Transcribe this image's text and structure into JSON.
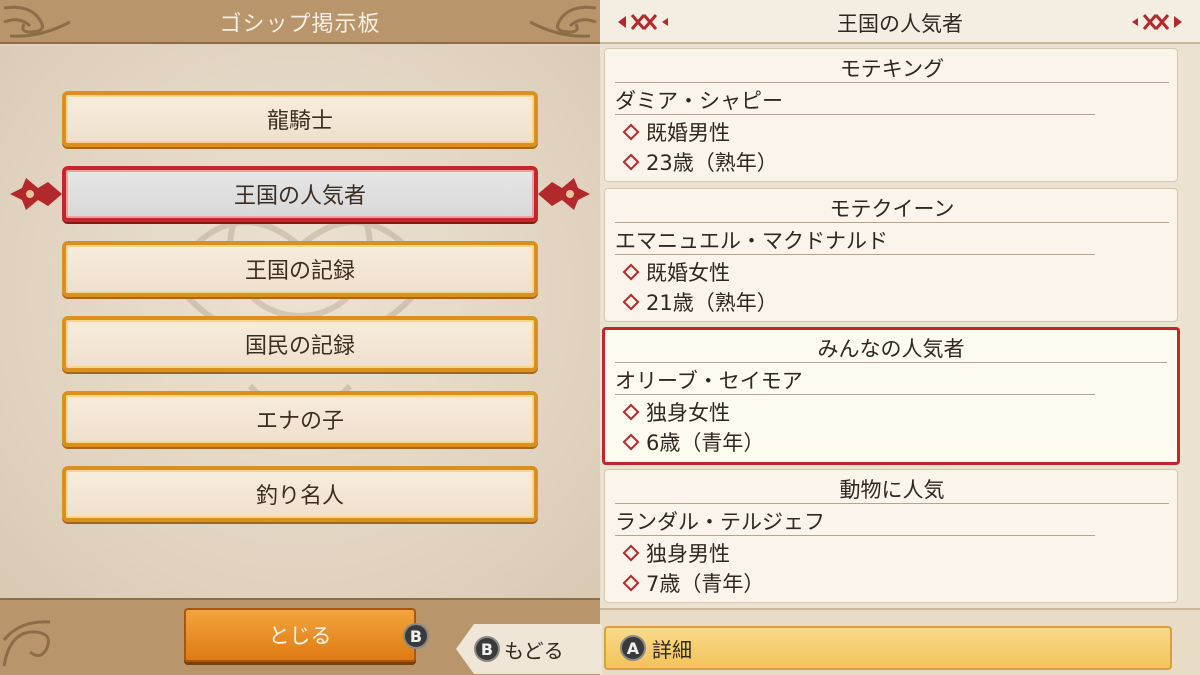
{
  "left": {
    "title": "ゴシップ掲示板",
    "menu": [
      {
        "label": "龍騎士"
      },
      {
        "label": "王国の人気者"
      },
      {
        "label": "王国の記録"
      },
      {
        "label": "国民の記録"
      },
      {
        "label": "エナの子"
      },
      {
        "label": "釣り名人"
      }
    ],
    "selected_index": 1,
    "close_label": "とじる",
    "close_button_glyph": "B"
  },
  "right": {
    "title": "王国の人気者",
    "cards": [
      {
        "category": "モテキング",
        "name": "ダミア・シャピー",
        "status": "既婚男性",
        "age": "23歳（熟年）"
      },
      {
        "category": "モテクイーン",
        "name": "エマニュエル・マクドナルド",
        "status": "既婚女性",
        "age": "21歳（熟年）"
      },
      {
        "category": "みんなの人気者",
        "name": "オリーブ・セイモア",
        "status": "独身女性",
        "age": "6歳（青年）"
      },
      {
        "category": "動物に人気",
        "name": "ランダル・テルジェフ",
        "status": "独身男性",
        "age": "7歳（青年）"
      }
    ],
    "selected_card_index": 2,
    "detail_glyph": "A",
    "detail_label": "詳細",
    "back_glyph": "B",
    "back_label": "もどる"
  },
  "colors": {
    "accent_orange": "#d9901f",
    "selection_red": "#c4262a",
    "header_tan": "#b8956b"
  },
  "icons": [
    "corner-scroll-ornament",
    "selection-ornament",
    "diamond-bullet-icon",
    "b-button-icon",
    "a-button-icon",
    "header-x-ornament"
  ]
}
